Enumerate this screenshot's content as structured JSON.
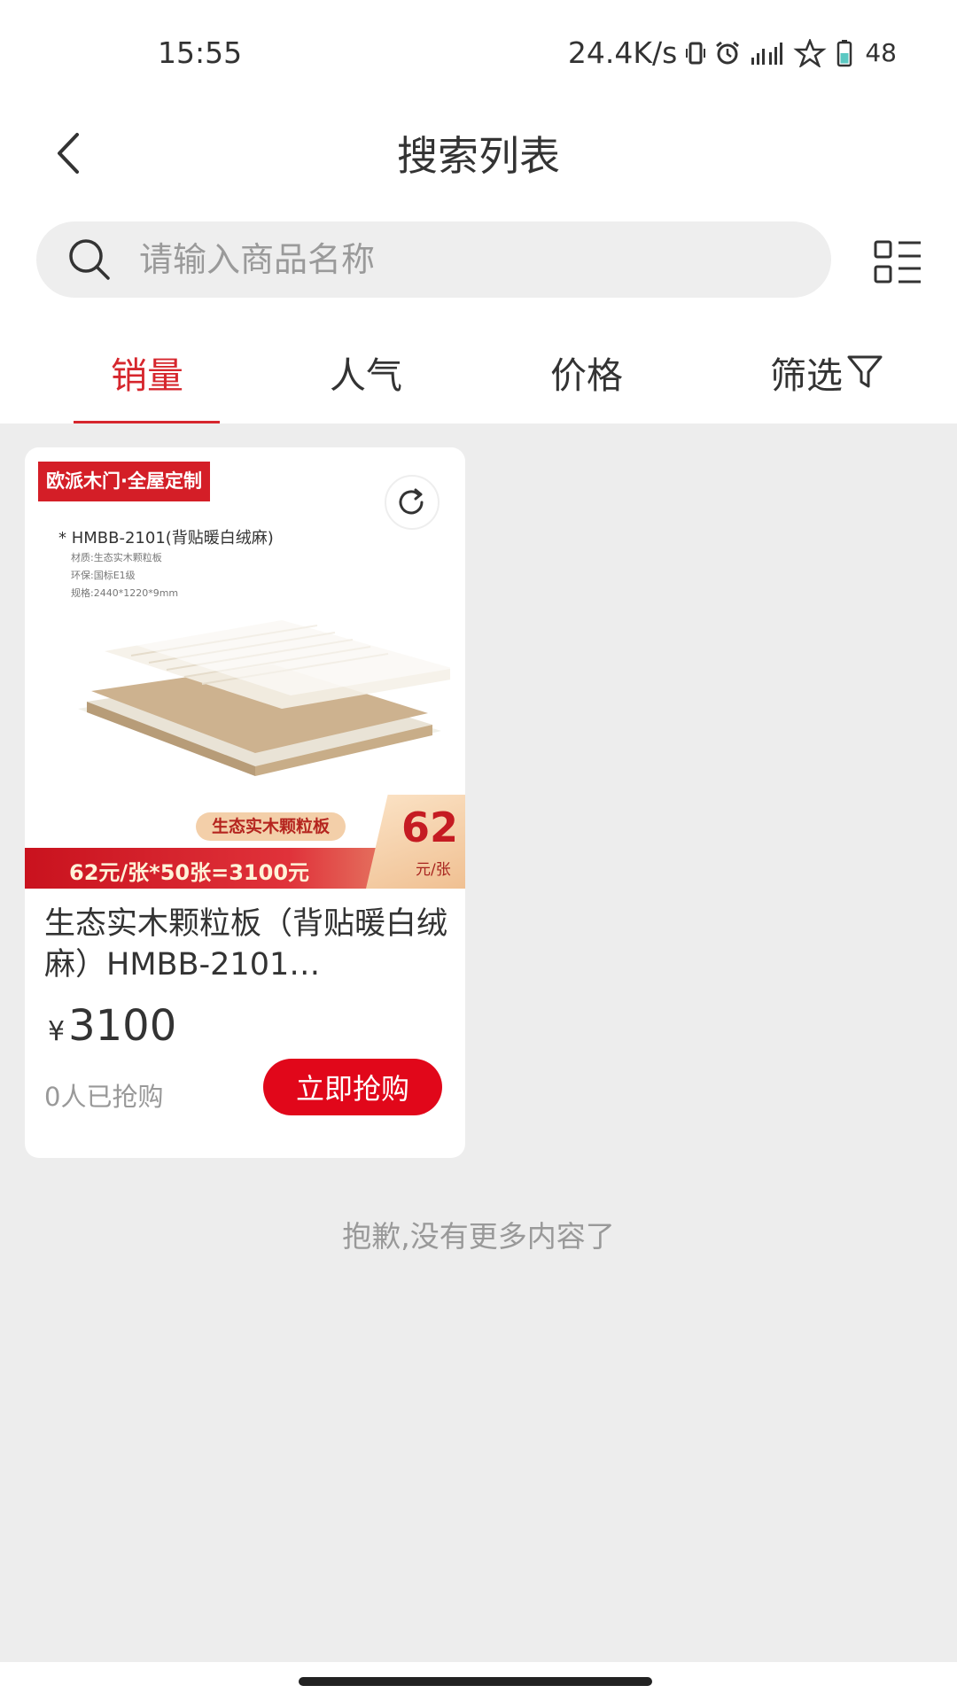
{
  "status_bar": {
    "time": "15:55",
    "network_speed": "24.4K/s",
    "battery": "48"
  },
  "header": {
    "title": "搜索列表"
  },
  "search": {
    "placeholder": "请输入商品名称",
    "value": ""
  },
  "sort_tabs": [
    {
      "label": "销量",
      "active": true
    },
    {
      "label": "人气",
      "active": false
    },
    {
      "label": "价格",
      "active": false
    },
    {
      "label": "筛选",
      "active": false,
      "icon": "funnel-icon"
    }
  ],
  "products": [
    {
      "image": {
        "brand_badge": "欧派木门·全屋定制",
        "spec_title": "* HMBB-2101(背贴暖白绒麻)",
        "spec_lines": [
          "材质:生态实木颗粒板",
          "环保:国标E1级",
          "规格:2440*1220*9mm"
        ],
        "promo_tag": "生态实木颗粒板",
        "promo_strip": "62元/张*50张=3100元",
        "price_box_value": "62",
        "price_box_unit": "元/张"
      },
      "title": "生态实木颗粒板（背贴暖白绒麻）HMBB-2101…",
      "currency": "¥",
      "price": "3100",
      "sold": "0人已抢购",
      "buy_label": "立即抢购"
    }
  ],
  "end_message": "抱歉,没有更多内容了",
  "colors": {
    "accent": "#d6262d",
    "buy_button": "#e1071a",
    "background": "#ededed"
  }
}
